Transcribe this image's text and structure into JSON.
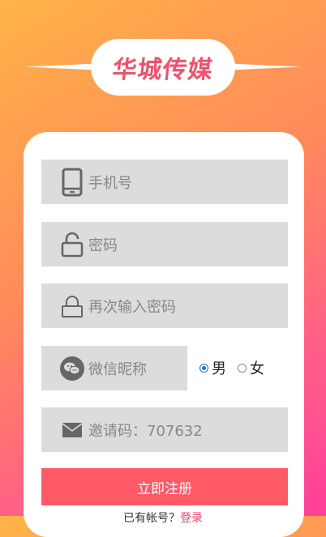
{
  "brand": {
    "logo_text": "华城传媒",
    "accent_color": "#f2506b"
  },
  "form": {
    "phone": {
      "placeholder": "手机号",
      "icon": "phone-icon"
    },
    "password": {
      "placeholder": "密码",
      "icon": "lock-icon"
    },
    "password_confirm": {
      "placeholder": "再次输入密码",
      "icon": "lock-icon"
    },
    "nickname": {
      "placeholder": "微信昵称",
      "icon": "wechat-icon"
    },
    "gender": {
      "options": [
        "男",
        "女"
      ],
      "selected": "男"
    },
    "invite": {
      "value": "邀请码：707632",
      "icon": "mail-icon"
    },
    "submit_label": "立即注册"
  },
  "footer": {
    "link_prefix": "已有帐号？",
    "link_text": "登录"
  },
  "colors": {
    "button_bg": "#ff5a66",
    "field_bg": "#dcdcdc",
    "radio_checked": "#1e6fd9"
  }
}
